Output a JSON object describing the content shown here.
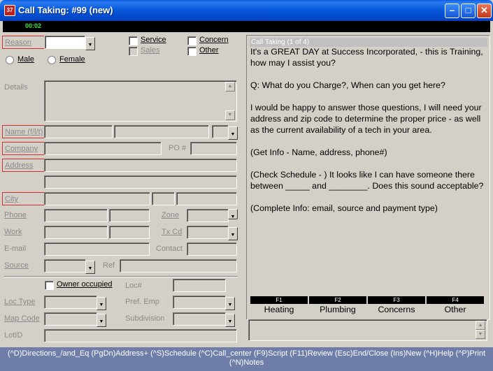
{
  "window": {
    "title": "Call Taking: #99 (new)",
    "app_icon_text": "37",
    "minimize_glyph": "–",
    "maximize_glyph": "□",
    "close_glyph": "✕"
  },
  "timer": "00:02",
  "form": {
    "reason_label": "Reason",
    "service_label": "Service",
    "concern_label": "Concern",
    "sales_label": "Sales",
    "other_label": "Other",
    "male_label": "Male",
    "female_label": "Female",
    "details_label": "Details",
    "name_label": "Name (f/l/t)",
    "company_label": "Company",
    "po_label": "PO #",
    "address_label": "Address",
    "city_label": "City",
    "phone_label": "Phone",
    "zone_label": "Zone",
    "work_label": "Work",
    "tx_label": "Tx Cd",
    "email_label": "E-mail",
    "contact_label": "Contact",
    "source_label": "Source",
    "ref_label": "Ref",
    "owner_label": "Owner occupied",
    "loc_num_label": "Loc#",
    "loc_type_label": "Loc Type",
    "pref_emp_label": "Pref. Emp",
    "map_code_label": "Map Code",
    "subdivision_label": "Subdivision",
    "lotid_label": "LotID"
  },
  "script": {
    "header": "Call Taking (1 of 4)",
    "paragraphs": [
      "It's a GREAT DAY at Success Incorporated, - this is Training, how may I assist you?",
      "Q:  What do you Charge?,  When can you get here?",
      "I would be happy to answer those questions, I will need your address and zip code to determine the proper price - as well as the current availability of a tech in your area.",
      "(Get Info - Name, address, phone#)",
      "(Check Schedule - )  It looks like I can have someone there between _____ and ________.  Does this sound acceptable?",
      "(Complete Info:  email,  source and payment type)"
    ]
  },
  "fkeys": [
    {
      "key": "F1",
      "label": "Heating"
    },
    {
      "key": "F2",
      "label": "Plumbing"
    },
    {
      "key": "F3",
      "label": "Concerns"
    },
    {
      "key": "F4",
      "label": "Other"
    }
  ],
  "bottom_bar": {
    "line1": "(^D)Directions_/and_Eq  (PgDn)Address+  (^S)Schedule  (^C)Call_center  (F9)Script  (F11)Review  (Esc)End/Close  (Ins)New  (^H)Help  (^P)Print",
    "line2": "(^N)Notes"
  }
}
